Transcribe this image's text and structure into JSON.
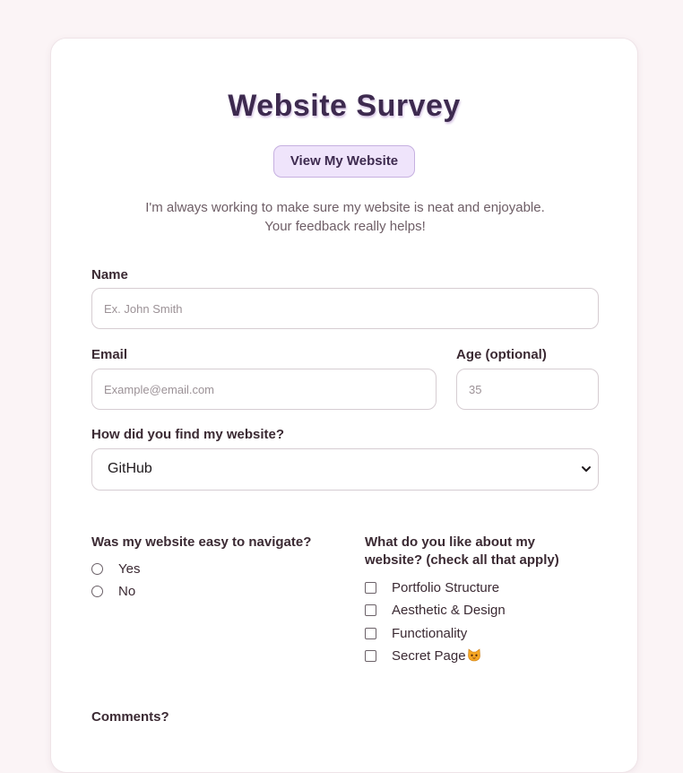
{
  "header": {
    "title": "Website Survey",
    "visit_button": "View My Website",
    "intro_line1": "I'm always working to make sure my website is neat and enjoyable.",
    "intro_line2": "Your feedback really helps!"
  },
  "form": {
    "name": {
      "label": "Name",
      "placeholder": "Ex. John Smith",
      "value": ""
    },
    "email": {
      "label": "Email",
      "placeholder": "Example@email.com",
      "value": ""
    },
    "age": {
      "label": "Age (optional)",
      "placeholder": "35",
      "value": ""
    },
    "source": {
      "label": "How did you find my website?",
      "selected": "GitHub"
    },
    "navigation": {
      "question": "Was my website easy to navigate?",
      "options": [
        "Yes",
        "No"
      ]
    },
    "likes": {
      "question_line1": "What do you like about my",
      "question_line2": "website? (check all that apply)",
      "options": [
        "Portfolio Structure",
        "Aesthetic & Design",
        "Functionality",
        "Secret Page"
      ],
      "secret_icon": "cat-face-icon"
    },
    "comments": {
      "label": "Comments?"
    }
  },
  "colors": {
    "page_bg": "#fbf4f6",
    "title": "#3d2a4f",
    "button_bg": "#efe4fb",
    "button_border": "#c6b0e0"
  }
}
